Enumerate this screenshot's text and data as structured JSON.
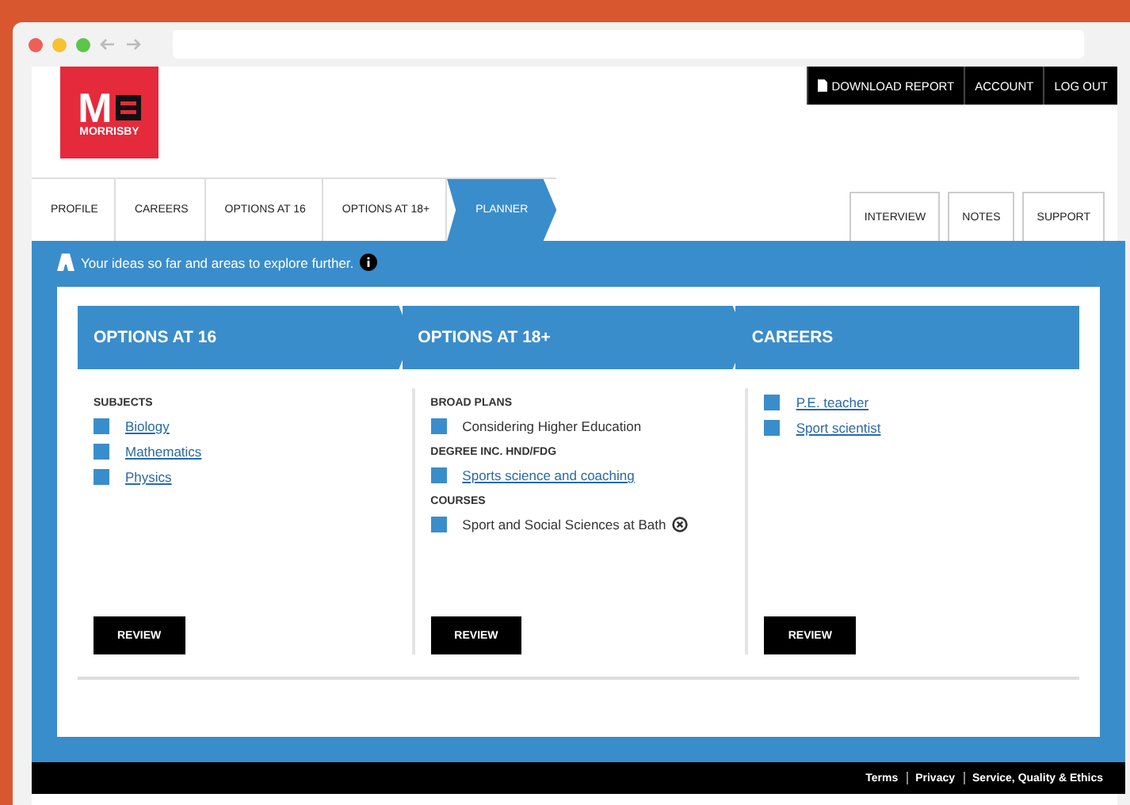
{
  "header_links": [
    {
      "label": "DOWNLOAD REPORT",
      "kind": "download"
    },
    {
      "label": "ACCOUNT",
      "kind": "plain"
    },
    {
      "label": "LOG OUT",
      "kind": "plain"
    }
  ],
  "logo": {
    "letter": "M",
    "name": "MORRISBY"
  },
  "breadcrumbs": [
    {
      "label": "PROFILE",
      "selected": false
    },
    {
      "label": "CAREERS",
      "selected": false
    },
    {
      "label": "OPTIONS AT 16",
      "selected": false
    },
    {
      "label": "OPTIONS AT 18+",
      "selected": false
    },
    {
      "label": "PLANNER",
      "selected": true
    }
  ],
  "side_tabs": [
    "INTERVIEW",
    "NOTES",
    "SUPPORT"
  ],
  "panel_title": "Your ideas so far and areas to explore further.",
  "columns": [
    {
      "title": "OPTIONS AT 16",
      "sections": [
        {
          "heading": "SUBJECTS",
          "items": [
            {
              "label": "Biology",
              "kind": "link"
            },
            {
              "label": "Mathematics",
              "kind": "link"
            },
            {
              "label": "Physics",
              "kind": "link"
            }
          ]
        }
      ],
      "button": "REVIEW"
    },
    {
      "title": "OPTIONS AT 18+",
      "sections": [
        {
          "heading": "BROAD PLANS",
          "items": [
            {
              "label": "Considering Higher Education",
              "kind": "text"
            }
          ]
        },
        {
          "heading": "DEGREE INC. HND/FDG",
          "items": [
            {
              "label": "Sports science and coaching",
              "kind": "link"
            }
          ]
        },
        {
          "heading": "COURSES",
          "items": [
            {
              "label": "Sport and Social Sciences at Bath",
              "kind": "removable"
            }
          ]
        }
      ],
      "button": "REVIEW"
    },
    {
      "title": "CAREERS",
      "sections": [
        {
          "items": [
            {
              "label": "P.E. teacher",
              "kind": "link"
            },
            {
              "label": "Sport scientist",
              "kind": "link"
            }
          ]
        }
      ],
      "button": "REVIEW"
    }
  ],
  "footer_links": [
    "Terms",
    "Privacy",
    "Service, Quality & Ethics"
  ]
}
